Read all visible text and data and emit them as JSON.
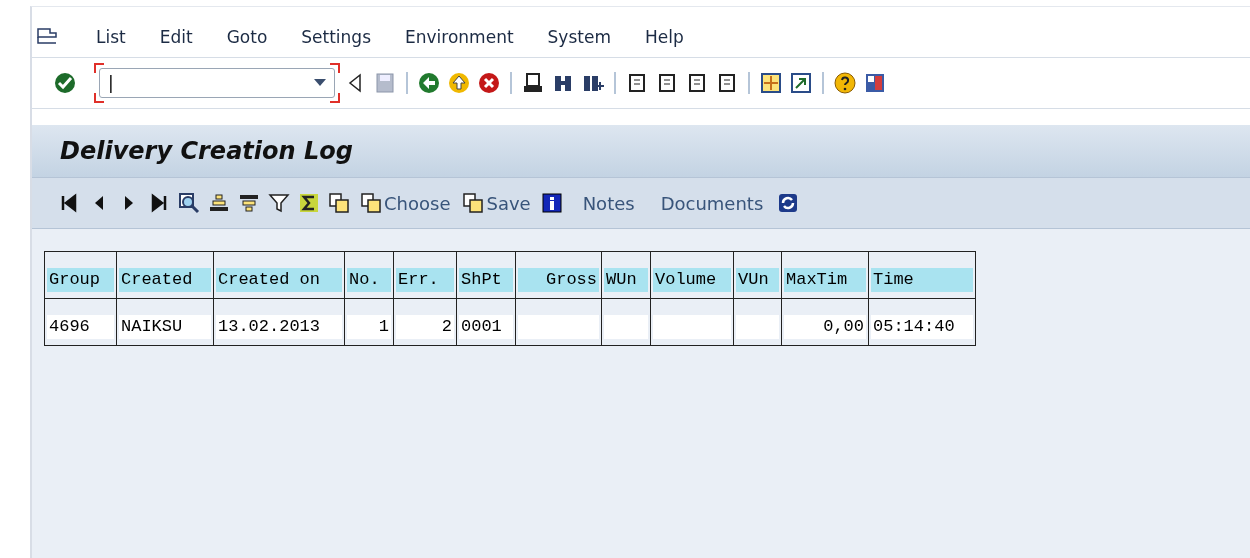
{
  "menu": [
    "List",
    "Edit",
    "Goto",
    "Settings",
    "Environment",
    "System",
    "Help"
  ],
  "command_field": {
    "value": "|"
  },
  "title": "Delivery Creation Log",
  "app_toolbar": [
    {
      "label": "Choose",
      "kind": "icon-text"
    },
    {
      "label": "Save",
      "kind": "icon-text"
    },
    {
      "label": "Notes",
      "kind": "text"
    },
    {
      "label": "Documents",
      "kind": "text"
    }
  ],
  "table": {
    "columns": [
      {
        "label": "Group",
        "kind": "text"
      },
      {
        "label": "Created",
        "kind": "text"
      },
      {
        "label": "Created on",
        "kind": "text"
      },
      {
        "label": "No.",
        "kind": "text"
      },
      {
        "label": "Err.",
        "kind": "text"
      },
      {
        "label": "ShPt",
        "kind": "text"
      },
      {
        "label": "Gross",
        "kind": "number"
      },
      {
        "label": "WUn",
        "kind": "text"
      },
      {
        "label": "Volume",
        "kind": "text"
      },
      {
        "label": "VUn",
        "kind": "text"
      },
      {
        "label": "MaxTim",
        "kind": "text"
      },
      {
        "label": "Time",
        "kind": "text"
      }
    ],
    "rows": [
      {
        "cells": [
          {
            "text": "4696",
            "kind": "text"
          },
          {
            "text": "NAIKSU",
            "kind": "text"
          },
          {
            "text": "13.02.2013",
            "kind": "text"
          },
          {
            "text": "1",
            "kind": "number"
          },
          {
            "text": "2",
            "kind": "number"
          },
          {
            "text": "0001",
            "kind": "text"
          },
          {
            "kind": "empty"
          },
          {
            "kind": "empty"
          },
          {
            "kind": "empty"
          },
          {
            "kind": "empty"
          },
          {
            "text": "0,00",
            "kind": "number"
          },
          {
            "text": "05:14:40",
            "kind": "text"
          }
        ]
      }
    ]
  }
}
